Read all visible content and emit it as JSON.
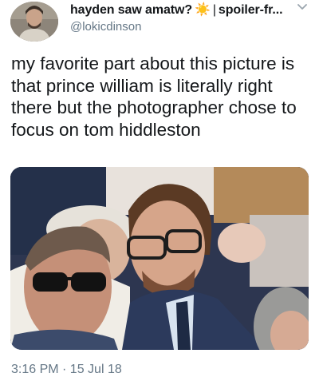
{
  "author": {
    "display_name": "hayden saw amatw?",
    "emoji": "☀️",
    "separator": "|",
    "display_name_tail": "spoiler-fr...",
    "handle": "@lokicdinson"
  },
  "tweet": {
    "text": "my favorite part about this picture is that prince william is literally right there but the photographer chose to focus on tom hiddleston"
  },
  "meta": {
    "timestamp": "3:16 PM · 15 Jul 18"
  },
  "icons": {
    "menu": "chevron-down-icon",
    "avatar": "avatar"
  },
  "colors": {
    "text": "#14171a",
    "secondary": "#657786",
    "emoji": "#f5a623"
  }
}
